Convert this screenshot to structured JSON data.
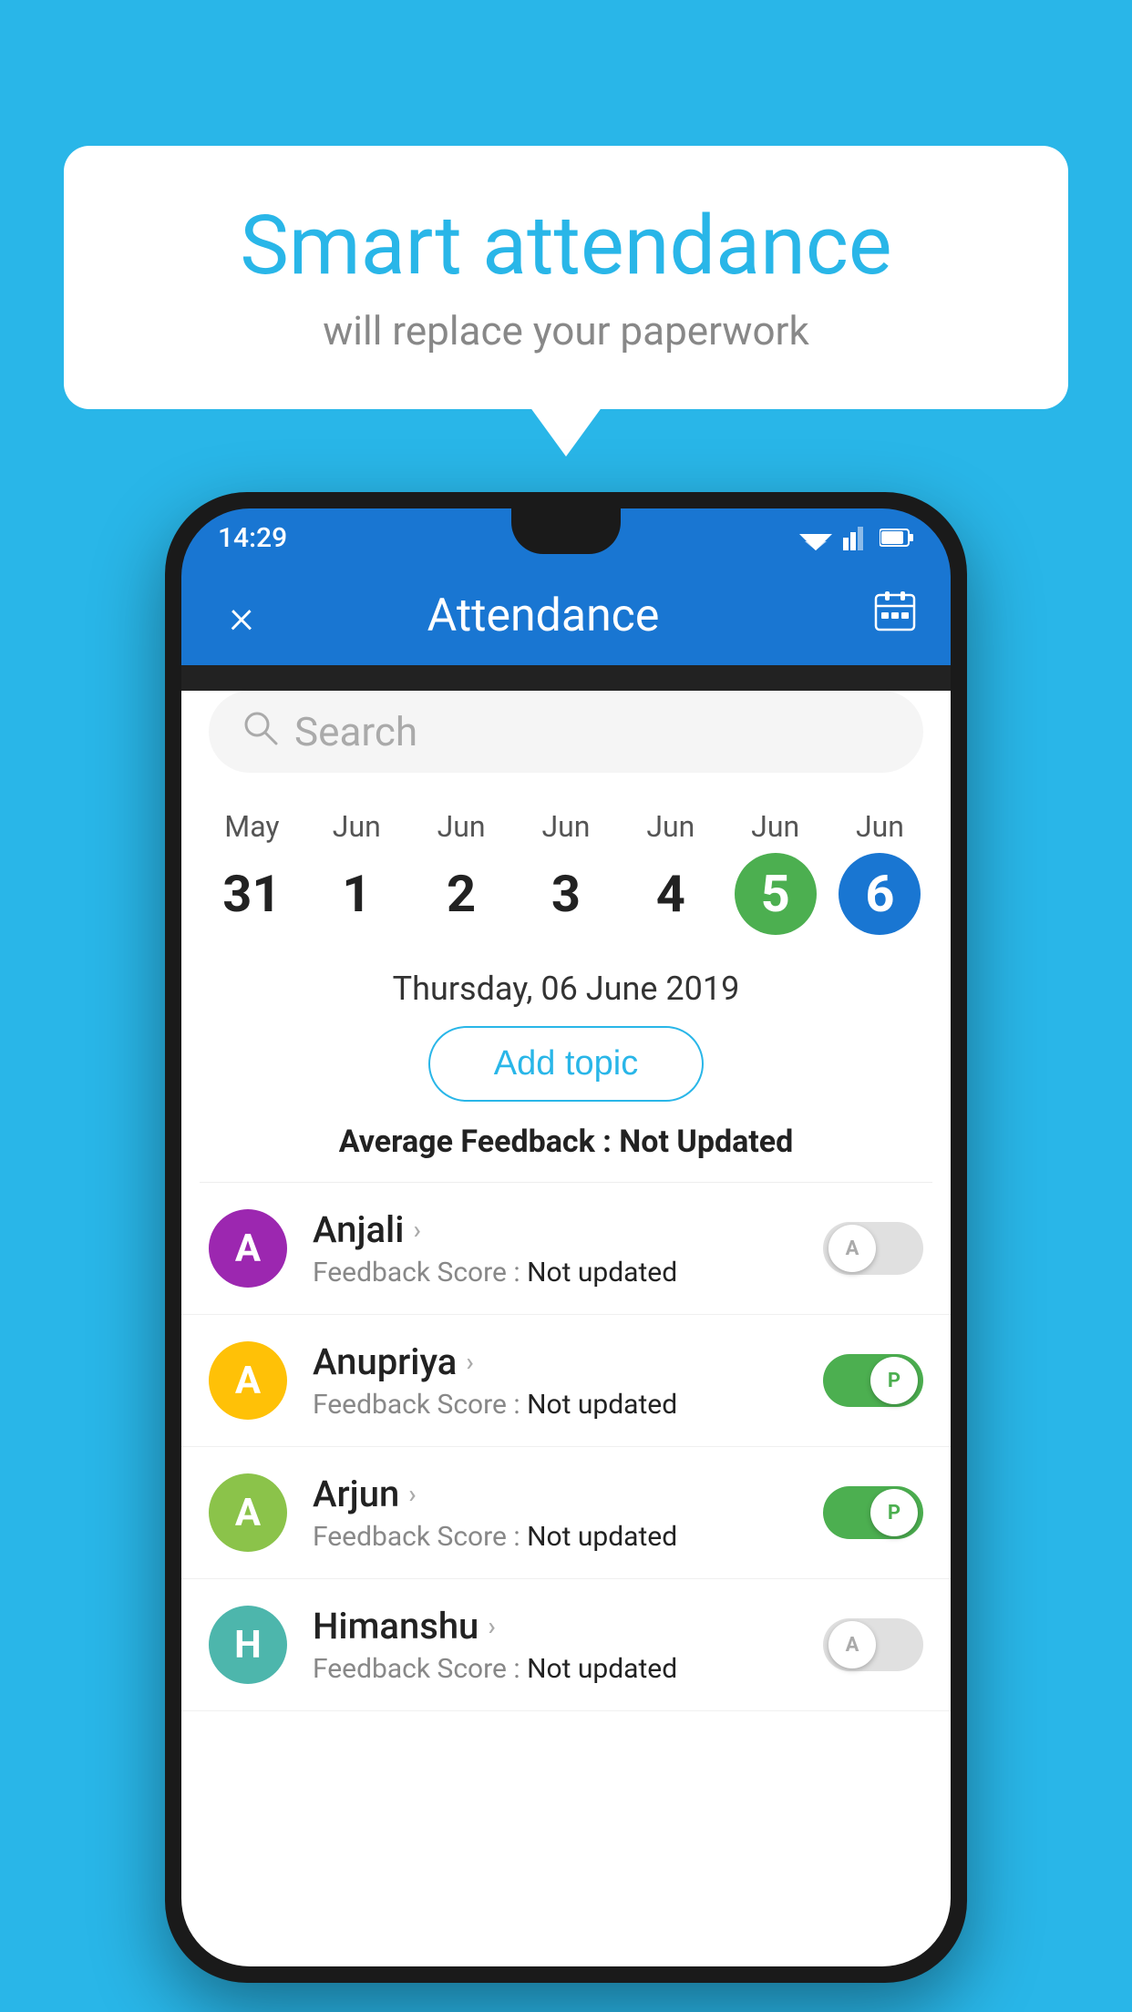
{
  "background_color": "#29b6e8",
  "bubble": {
    "title": "Smart attendance",
    "subtitle": "will replace your paperwork"
  },
  "status_bar": {
    "time": "14:29"
  },
  "app_bar": {
    "close_label": "×",
    "title": "Attendance",
    "calendar_icon": "📅"
  },
  "search": {
    "placeholder": "Search"
  },
  "calendar": {
    "days": [
      {
        "month": "May",
        "date": "31",
        "style": "normal"
      },
      {
        "month": "Jun",
        "date": "1",
        "style": "normal"
      },
      {
        "month": "Jun",
        "date": "2",
        "style": "normal"
      },
      {
        "month": "Jun",
        "date": "3",
        "style": "normal"
      },
      {
        "month": "Jun",
        "date": "4",
        "style": "normal"
      },
      {
        "month": "Jun",
        "date": "5",
        "style": "green"
      },
      {
        "month": "Jun",
        "date": "6",
        "style": "blue"
      }
    ]
  },
  "selected_date": "Thursday, 06 June 2019",
  "add_topic_label": "Add topic",
  "average_feedback": {
    "label": "Average Feedback : ",
    "value": "Not Updated"
  },
  "students": [
    {
      "name": "Anjali",
      "avatar_letter": "A",
      "avatar_color": "purple",
      "feedback_label": "Feedback Score : ",
      "feedback_value": "Not updated",
      "toggle": "off",
      "toggle_letter": "A"
    },
    {
      "name": "Anupriya",
      "avatar_letter": "A",
      "avatar_color": "yellow",
      "feedback_label": "Feedback Score : ",
      "feedback_value": "Not updated",
      "toggle": "on",
      "toggle_letter": "P"
    },
    {
      "name": "Arjun",
      "avatar_letter": "A",
      "avatar_color": "light-green",
      "feedback_label": "Feedback Score : ",
      "feedback_value": "Not updated",
      "toggle": "on",
      "toggle_letter": "P"
    },
    {
      "name": "Himanshu",
      "avatar_letter": "H",
      "avatar_color": "teal",
      "feedback_label": "Feedback Score : ",
      "feedback_value": "Not updated",
      "toggle": "off",
      "toggle_letter": "A"
    }
  ]
}
